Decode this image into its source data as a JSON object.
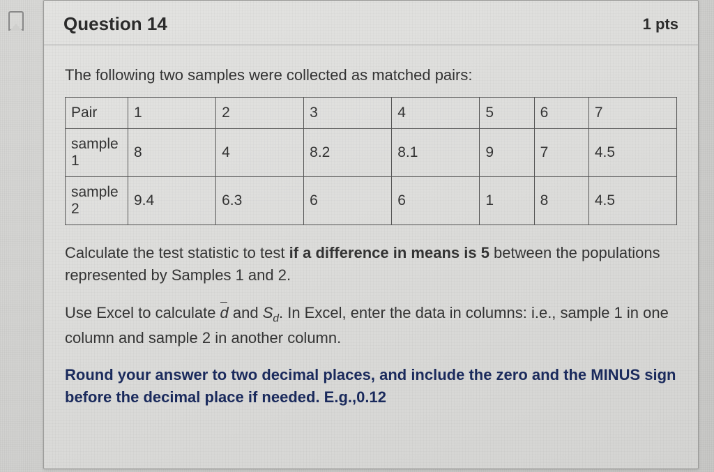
{
  "header": {
    "title": "Question 14",
    "points": "1 pts"
  },
  "prompt": "The following two samples were collected as matched pairs:",
  "table": {
    "rows": [
      {
        "label": "Pair",
        "cells": [
          "1",
          "2",
          "3",
          "4",
          "5",
          "6",
          "7"
        ]
      },
      {
        "label": "sample 1",
        "cells": [
          "8",
          "4",
          "8.2",
          "8.1",
          "9",
          "7",
          "4.5"
        ]
      },
      {
        "label": "sample 2",
        "cells": [
          "9.4",
          "6.3",
          "6",
          "6",
          "1",
          "8",
          "4.5"
        ]
      }
    ]
  },
  "para1_a": "Calculate the test statistic to test ",
  "para1_bold": "if a difference in means is 5",
  "para1_b": " between the populations represented by Samples 1 and 2.",
  "para2_a": "Use Excel to calculate ",
  "para2_dbar": "d",
  "para2_mid": " and ",
  "para2_sd_main": "S",
  "para2_sd_sub": "d",
  "para2_b": ".  In Excel, enter the data in columns: i.e., sample 1 in one column and sample 2 in another column.",
  "para3": "Round your answer to two decimal places, and include the zero and the MINUS sign before the decimal place if needed. E.g.,0.12",
  "chart_data": {
    "type": "table",
    "title": "Matched pairs samples",
    "columns": [
      "Pair",
      "1",
      "2",
      "3",
      "4",
      "5",
      "6",
      "7"
    ],
    "rows": [
      {
        "label": "sample 1",
        "values": [
          8,
          4,
          8.2,
          8.1,
          9,
          7,
          4.5
        ]
      },
      {
        "label": "sample 2",
        "values": [
          9.4,
          6.3,
          6,
          6,
          1,
          8,
          4.5
        ]
      }
    ]
  }
}
